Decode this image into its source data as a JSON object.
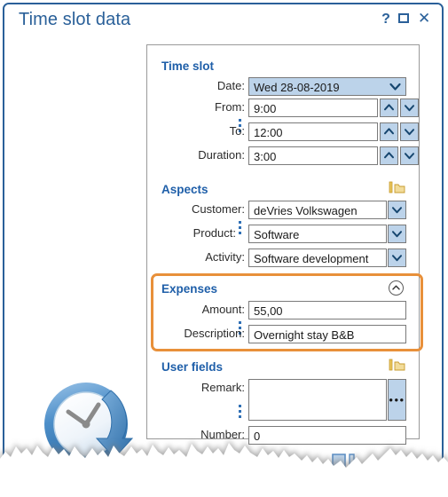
{
  "window": {
    "title": "Time slot data",
    "controls": [
      {
        "name": "help",
        "glyph": "?"
      },
      {
        "name": "maximize",
        "glyph": "□"
      },
      {
        "name": "close",
        "glyph": "✕"
      }
    ]
  },
  "sections": {
    "time_slot": {
      "title": "Time slot",
      "fields": {
        "date": {
          "label": "Date:",
          "value": "Wed 28-08-2019",
          "control": "combobox-filled"
        },
        "from": {
          "label": "From:",
          "value": "9:00",
          "control": "spinner"
        },
        "to": {
          "label": "To:",
          "value": "12:00",
          "control": "spinner"
        },
        "duration": {
          "label": "Duration:",
          "value": "3:00",
          "control": "spinner"
        }
      }
    },
    "aspects": {
      "title": "Aspects",
      "header_icon": "folder-gold-icon",
      "fields": {
        "customer": {
          "label": "Customer:",
          "value": "deVries Volkswagen",
          "control": "combobox"
        },
        "product": {
          "label": "Product:",
          "value": "Software",
          "control": "combobox"
        },
        "activity": {
          "label": "Activity:",
          "value": "Software development",
          "control": "combobox"
        }
      }
    },
    "expenses": {
      "title": "Expenses",
      "collapse_glyph": "⌃",
      "highlighted": true,
      "fields": {
        "amount": {
          "label": "Amount:",
          "value": "55,00"
        },
        "description": {
          "label": "Description:",
          "value": "Overnight stay B&B"
        }
      }
    },
    "user_fields": {
      "title": "User fields",
      "header_icon": "folder-gold-icon",
      "fields": {
        "remark": {
          "label": "Remark:",
          "value": "",
          "browse_label": "•••"
        },
        "number": {
          "label": "Number:",
          "value": "0"
        }
      }
    }
  },
  "colors": {
    "window_border": "#2a6099",
    "title_text": "#2a6099",
    "section_header": "#1f5fa9",
    "control_blue": "#bcd3ea",
    "highlight_orange": "#e8903a",
    "field_border": "#7a7a7a",
    "gold_icon": "#e8c45a"
  }
}
